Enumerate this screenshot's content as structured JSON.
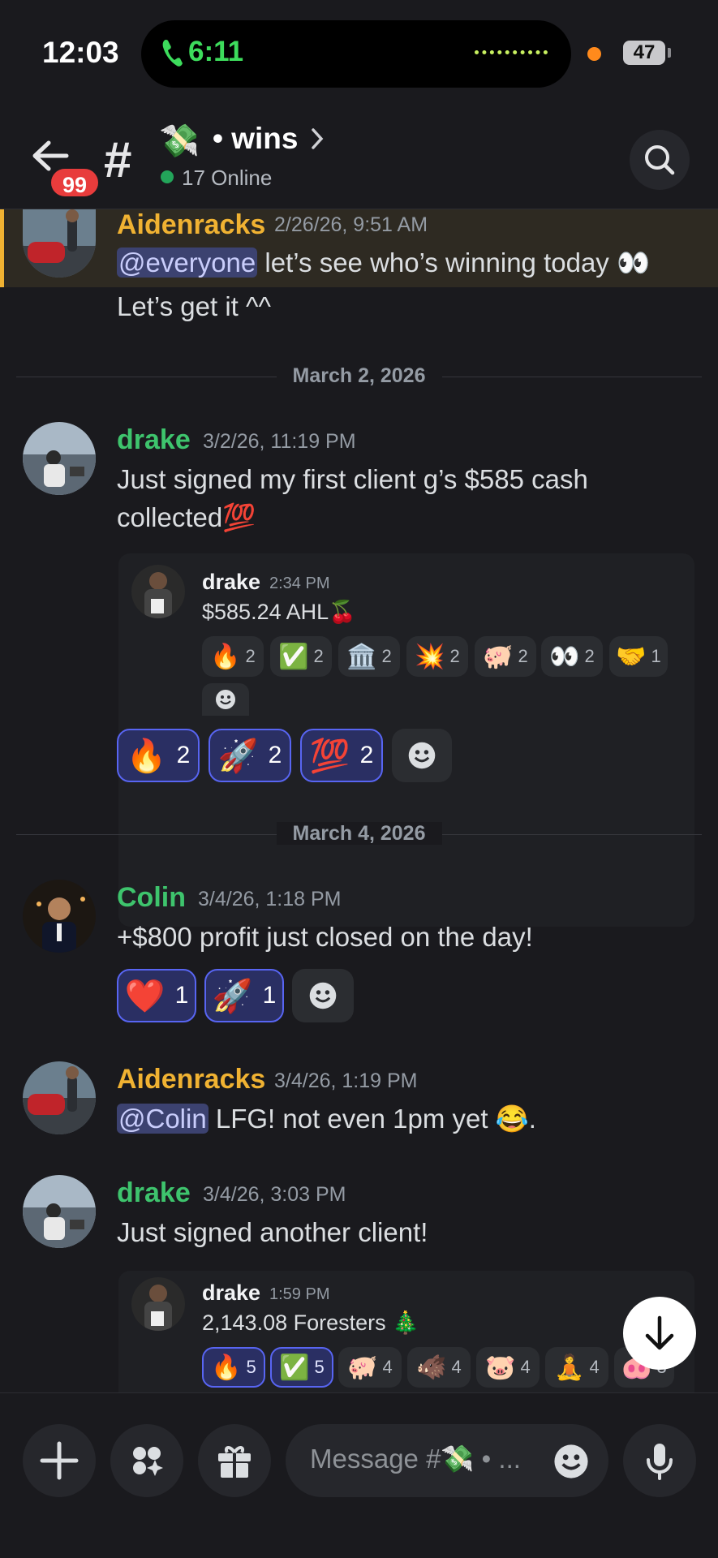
{
  "status_bar": {
    "time": "12:03",
    "call_time": "6:11",
    "battery": "47"
  },
  "header": {
    "badge": "99",
    "channel_prefix": "#",
    "channel_emoji": "💸",
    "channel_name": "• wins",
    "online": "17 Online"
  },
  "messages": [
    {
      "author": "Aidenracks",
      "timestamp": "2/26/26, 9:51 AM",
      "mention": "@everyone",
      "text_line1": " let’s see who’s winning today 👀",
      "text_line2": "Let’s get it ^^"
    },
    {
      "divider": "March 2, 2026"
    },
    {
      "author": "drake",
      "timestamp": "3/2/26, 11:19 PM",
      "text_line1": "Just signed my first client g’s $585 cash",
      "text_line2": "collected💯",
      "forward": {
        "author": "drake",
        "timestamp": "2:34 PM",
        "text": "$585.24 AHL🍒",
        "reactions": [
          {
            "emoji": "🔥",
            "count": "2"
          },
          {
            "emoji": "✅",
            "count": "2"
          },
          {
            "emoji": "🏛️",
            "count": "2"
          },
          {
            "emoji": "💥",
            "count": "2"
          },
          {
            "emoji": "🐖",
            "count": "2"
          },
          {
            "emoji": "👀",
            "count": "2"
          },
          {
            "emoji": "🤝",
            "count": "1"
          }
        ]
      },
      "reactions": [
        {
          "emoji": "🔥",
          "count": "2"
        },
        {
          "emoji": "🚀",
          "count": "2"
        },
        {
          "emoji": "💯",
          "count": "2"
        }
      ]
    },
    {
      "divider": "March 4, 2026"
    },
    {
      "author": "Colin",
      "timestamp": "3/4/26, 1:18 PM",
      "text_line1": "+$800 profit just closed on the day!",
      "reactions": [
        {
          "emoji": "❤️",
          "count": "1"
        },
        {
          "emoji": "🚀",
          "count": "1"
        }
      ]
    },
    {
      "author": "Aidenracks",
      "timestamp": "3/4/26, 1:19 PM",
      "mention": "@Colin",
      "text_line1": " LFG! not even 1pm yet 😂."
    },
    {
      "author": "drake",
      "timestamp": "3/4/26, 3:03 PM",
      "text_line1": "Just signed another client!",
      "forward": {
        "author": "drake",
        "timestamp": "1:59 PM",
        "text": "2,143.08 Foresters 🎄",
        "reactions": [
          {
            "emoji": "🔥",
            "count": "5"
          },
          {
            "emoji": "✅",
            "count": "5"
          },
          {
            "emoji": "🐖",
            "count": "4"
          },
          {
            "emoji": "🐗",
            "count": "4"
          },
          {
            "emoji": "🐷",
            "count": "4"
          },
          {
            "emoji": "🧘",
            "count": "4"
          },
          {
            "emoji": "🐽",
            "count": "3"
          }
        ]
      }
    }
  ],
  "composer": {
    "placeholder": "Message #💸 • ..."
  },
  "colors": {
    "aidenracks": "#f0b232",
    "drake": "#3ec46d",
    "colin": "#3ec46d",
    "accent": "#5865f2"
  }
}
